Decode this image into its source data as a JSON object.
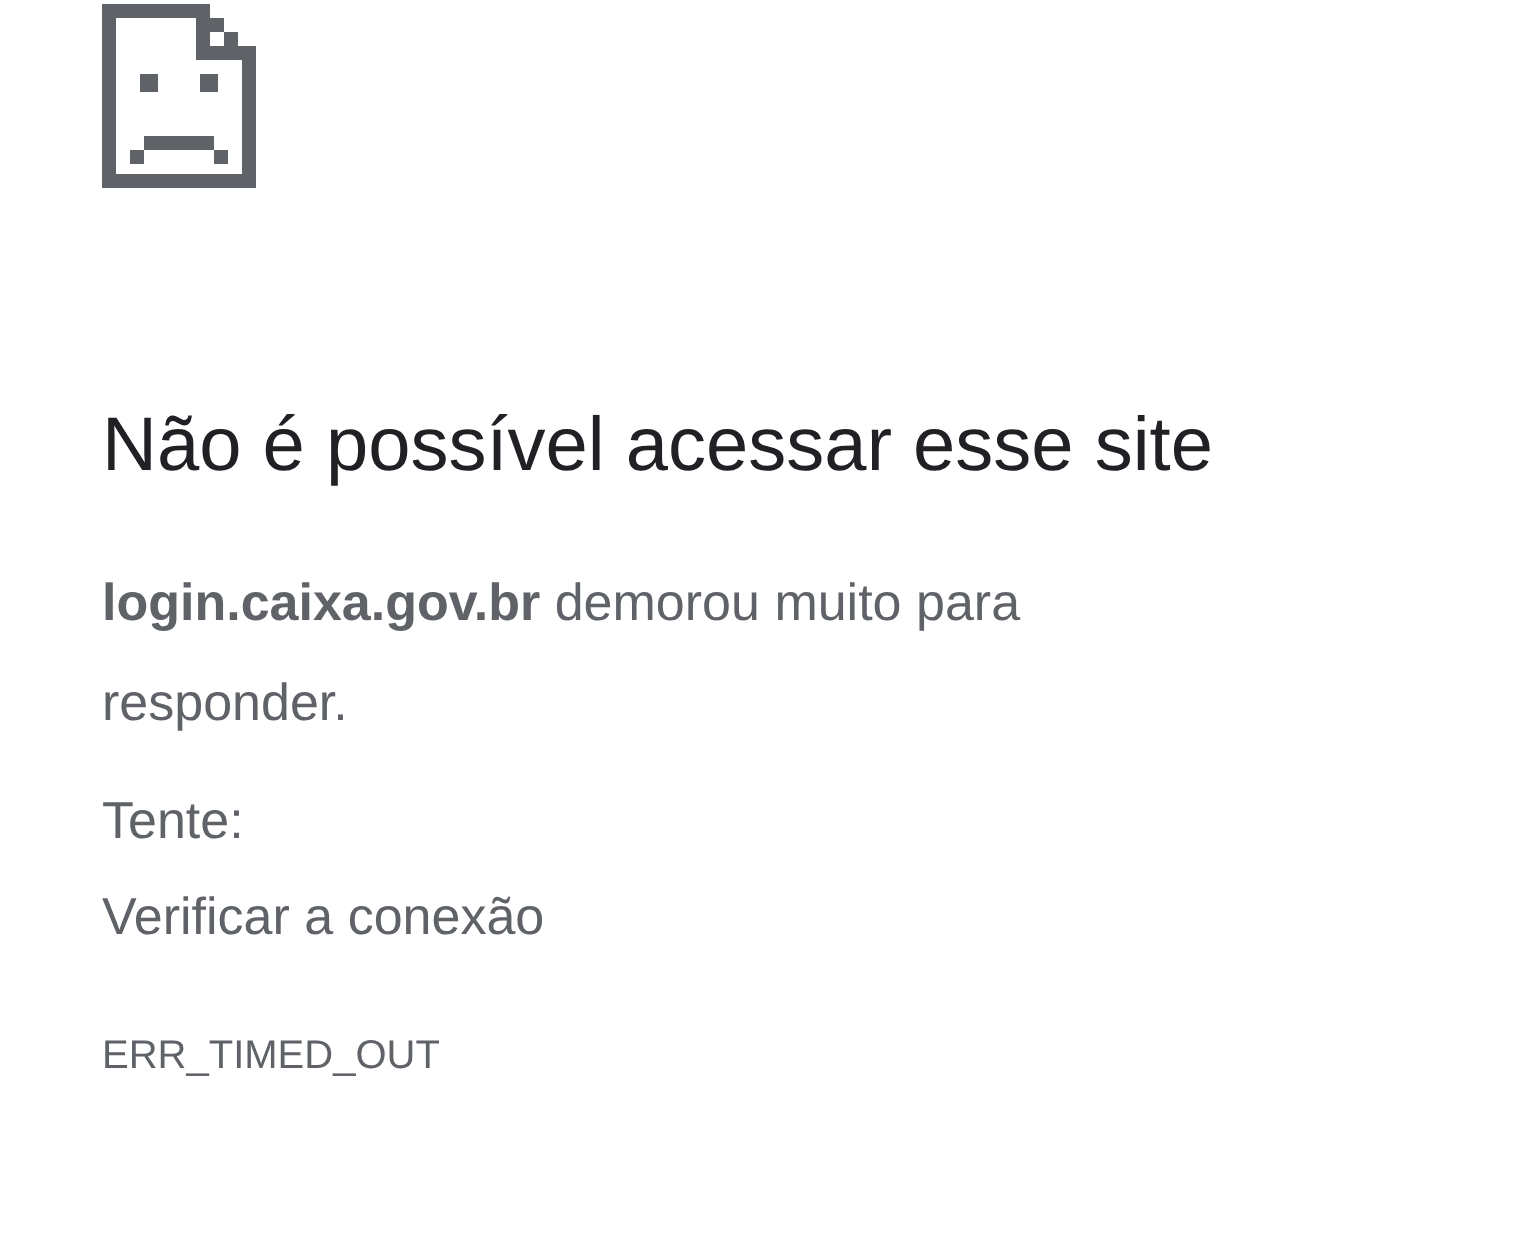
{
  "heading": "Não é possível acessar esse site",
  "message": "**login.caixa.gov.br** demorou muito para responder.",
  "suggestions_label": "Tente:",
  "suggestions": [
    "Verificar a conexão"
  ],
  "error_code": "ERR_TIMED_OUT"
}
